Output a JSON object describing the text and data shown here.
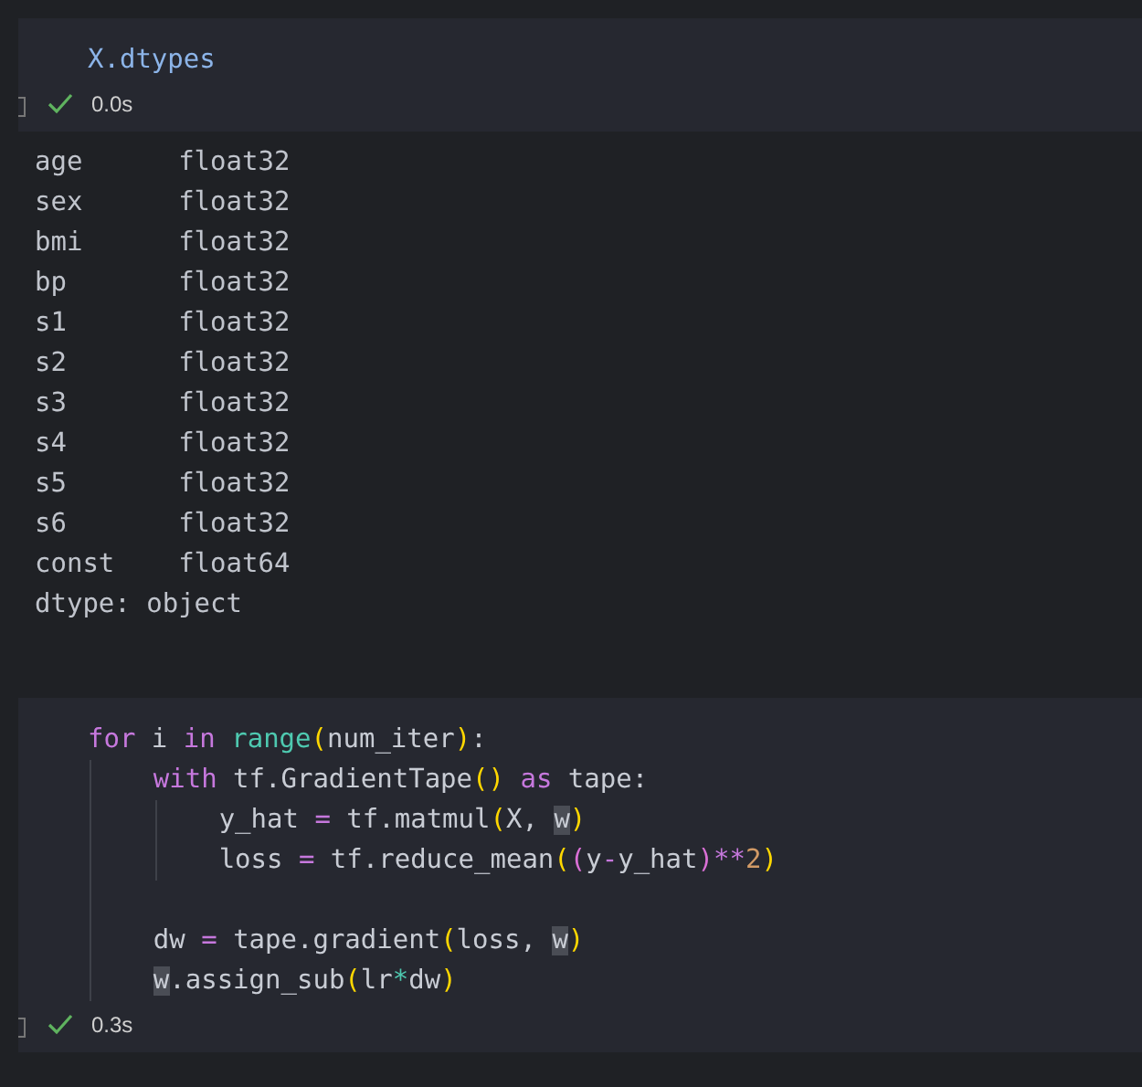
{
  "cells": [
    {
      "code": [
        {
          "kind": "line",
          "tokens": [
            {
              "kind": "name",
              "text": "X.dtypes"
            }
          ]
        }
      ],
      "status": {
        "ok": true,
        "time": "0.0s"
      },
      "output": [
        "age      float32",
        "sex      float32",
        "bmi      float32",
        "bp       float32",
        "s1       float32",
        "s2       float32",
        "s3       float32",
        "s4       float32",
        "s5       float32",
        "s6       float32",
        "const    float64",
        "dtype: object"
      ]
    },
    {
      "code": [
        {
          "kind": "line",
          "tokens": [
            {
              "kind": "keyword",
              "text": "for"
            },
            {
              "kind": "plain",
              "text": " i "
            },
            {
              "kind": "keyword",
              "text": "in"
            },
            {
              "kind": "builtin",
              "text": " range"
            },
            {
              "kind": "paren",
              "text": "("
            },
            {
              "kind": "plain",
              "text": "num_iter"
            },
            {
              "kind": "paren",
              "text": ")"
            },
            {
              "kind": "plain",
              "text": ":"
            }
          ],
          "children": [
            {
              "kind": "line",
              "tokens": [
                {
                  "kind": "keyword",
                  "text": "with"
                },
                {
                  "kind": "plain",
                  "text": " tf.GradientTape"
                },
                {
                  "kind": "paren",
                  "text": "()"
                },
                {
                  "kind": "keyword",
                  "text": " as"
                },
                {
                  "kind": "plain",
                  "text": " tape:"
                }
              ],
              "children": [
                {
                  "kind": "line",
                  "tokens": [
                    {
                      "kind": "plain",
                      "text": "y_hat "
                    },
                    {
                      "kind": "operator",
                      "text": "="
                    },
                    {
                      "kind": "plain",
                      "text": " tf.matmul"
                    },
                    {
                      "kind": "paren",
                      "text": "("
                    },
                    {
                      "kind": "plain",
                      "text": "X, "
                    },
                    {
                      "kind": "highlight",
                      "text": "w"
                    },
                    {
                      "kind": "paren",
                      "text": ")"
                    }
                  ]
                },
                {
                  "kind": "line",
                  "tokens": [
                    {
                      "kind": "plain",
                      "text": "loss "
                    },
                    {
                      "kind": "operator",
                      "text": "="
                    },
                    {
                      "kind": "plain",
                      "text": " tf.reduce_mean"
                    },
                    {
                      "kind": "paren",
                      "text": "("
                    },
                    {
                      "kind": "paren2",
                      "text": "("
                    },
                    {
                      "kind": "plain",
                      "text": "y"
                    },
                    {
                      "kind": "operator",
                      "text": "-"
                    },
                    {
                      "kind": "plain",
                      "text": "y_hat"
                    },
                    {
                      "kind": "paren2",
                      "text": ")"
                    },
                    {
                      "kind": "operator",
                      "text": "**"
                    },
                    {
                      "kind": "number",
                      "text": "2"
                    },
                    {
                      "kind": "paren",
                      "text": ")"
                    }
                  ]
                }
              ]
            },
            {
              "kind": "blank"
            },
            {
              "kind": "line",
              "tokens": [
                {
                  "kind": "plain",
                  "text": "dw "
                },
                {
                  "kind": "operator",
                  "text": "="
                },
                {
                  "kind": "plain",
                  "text": " tape.gradient"
                },
                {
                  "kind": "paren",
                  "text": "("
                },
                {
                  "kind": "plain",
                  "text": "loss, "
                },
                {
                  "kind": "highlight",
                  "text": "w"
                },
                {
                  "kind": "paren",
                  "text": ")"
                }
              ]
            },
            {
              "kind": "line",
              "tokens": [
                {
                  "kind": "highlight",
                  "text": "w"
                },
                {
                  "kind": "plain",
                  "text": ".assign_sub"
                },
                {
                  "kind": "paren",
                  "text": "("
                },
                {
                  "kind": "plain",
                  "text": "lr"
                },
                {
                  "kind": "operator2",
                  "text": "*"
                },
                {
                  "kind": "plain",
                  "text": "dw"
                },
                {
                  "kind": "paren",
                  "text": ")"
                }
              ]
            }
          ]
        }
      ],
      "status": {
        "ok": true,
        "time": "0.3s"
      }
    }
  ]
}
